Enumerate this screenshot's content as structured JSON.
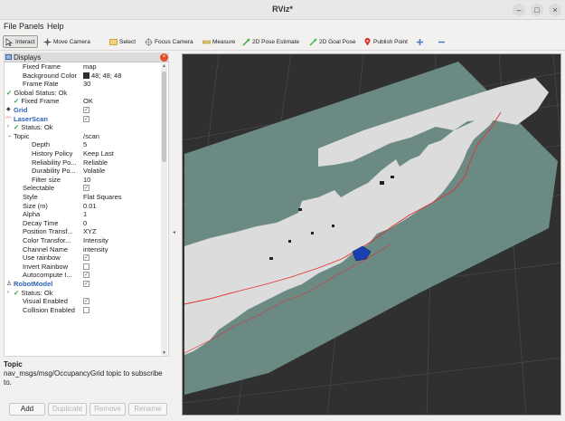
{
  "window": {
    "title": "RViz*"
  },
  "window_controls": {
    "minimize": "–",
    "maximize": "□",
    "close": "×"
  },
  "menu": [
    "File",
    "Panels",
    "Help"
  ],
  "toolbar": [
    {
      "label": "Interact",
      "icon": "cursor-icon"
    },
    {
      "label": "Move Camera",
      "icon": "move-camera-icon"
    },
    {
      "label": "Select",
      "icon": "select-icon"
    },
    {
      "label": "Focus Camera",
      "icon": "focus-camera-icon"
    },
    {
      "label": "Measure",
      "icon": "measure-icon"
    },
    {
      "label": "2D Pose Estimate",
      "icon": "pose-estimate-icon"
    },
    {
      "label": "2D Goal Pose",
      "icon": "goal-pose-icon"
    },
    {
      "label": "Publish Point",
      "icon": "publish-point-icon"
    }
  ],
  "displays_panel": {
    "title": "Displays"
  },
  "tree": [
    {
      "k": "Fixed Frame",
      "v": "map"
    },
    {
      "k": "Background Color",
      "v": "48; 48; 48"
    },
    {
      "k": "Frame Rate",
      "v": "30"
    },
    {
      "k": "Global Status: Ok",
      "v": ""
    },
    {
      "k": "Fixed Frame",
      "v": "OK"
    },
    {
      "k": "Grid",
      "v": ""
    },
    {
      "k": "LaserScan",
      "v": ""
    },
    {
      "k": "Status: Ok",
      "v": ""
    },
    {
      "k": "Topic",
      "v": "/scan"
    },
    {
      "k": "Depth",
      "v": "5"
    },
    {
      "k": "History Policy",
      "v": "Keep Last"
    },
    {
      "k": "Reliability Po...",
      "v": "Reliable"
    },
    {
      "k": "Durability Po...",
      "v": "Volatile"
    },
    {
      "k": "Filter size",
      "v": "10"
    },
    {
      "k": "Selectable",
      "v": ""
    },
    {
      "k": "Style",
      "v": "Flat Squares"
    },
    {
      "k": "Size (m)",
      "v": "0.01"
    },
    {
      "k": "Alpha",
      "v": "1"
    },
    {
      "k": "Decay Time",
      "v": "0"
    },
    {
      "k": "Position Transf...",
      "v": "XYZ"
    },
    {
      "k": "Color Transfor...",
      "v": "Intensity"
    },
    {
      "k": "Channel Name",
      "v": "intensity"
    },
    {
      "k": "Use rainbow",
      "v": ""
    },
    {
      "k": "Invert Rainbow",
      "v": ""
    },
    {
      "k": "Autocompute I...",
      "v": ""
    },
    {
      "k": "RobotModel",
      "v": ""
    },
    {
      "k": "Status: Ok",
      "v": ""
    },
    {
      "k": "Visual Enabled",
      "v": ""
    },
    {
      "k": "Collision Enabled",
      "v": ""
    }
  ],
  "description": {
    "title": "Topic",
    "text": "nav_msgs/msg/OccupancyGrid topic to subscribe to."
  },
  "buttons": {
    "add": "Add",
    "duplicate": "Duplicate",
    "remove": "Remove",
    "rename": "Rename"
  },
  "colors": {
    "background": "#303030",
    "map_free": "#dcdcdc",
    "map_unknown": "#6c8a84",
    "laser": "#e03030",
    "robot": "#1a3fb0"
  }
}
